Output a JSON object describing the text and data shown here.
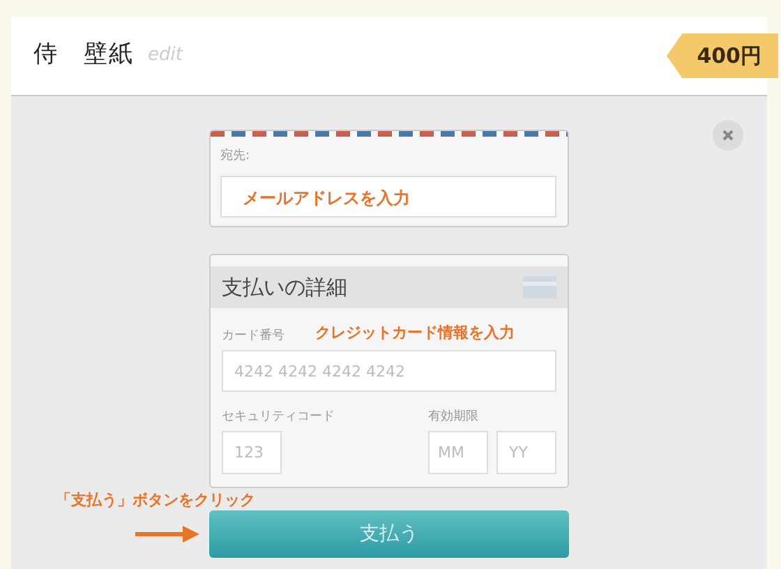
{
  "header": {
    "title": "侍　壁紙",
    "edit_link": "edit",
    "price": "400円"
  },
  "recipient": {
    "label": "宛先:",
    "annotation": "メールアドレスを入力"
  },
  "payment": {
    "title": "支払いの詳細",
    "card_label": "カード番号",
    "card_annotation": "クレジットカード情報を入力",
    "card_placeholder": "4242 4242 4242 4242",
    "cvc_label": "セキュリティコード",
    "cvc_placeholder": "123",
    "expiry_label": "有効期限",
    "month_placeholder": "MM",
    "year_placeholder": "YY"
  },
  "button_annotation": "「支払う」ボタンをクリック",
  "pay_button": "支払う"
}
